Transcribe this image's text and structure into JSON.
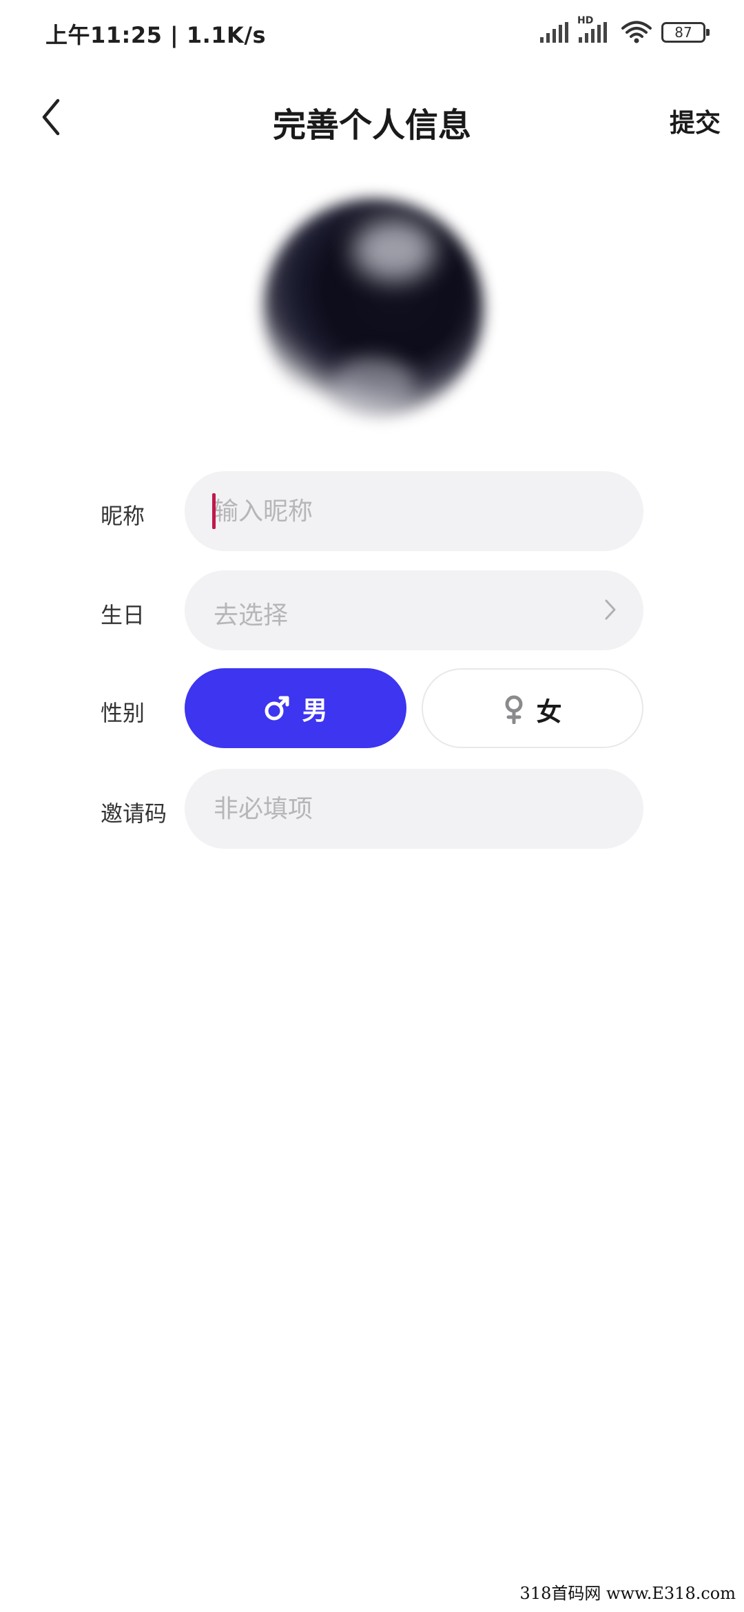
{
  "status_bar": {
    "time_speed": "上午11:25 | 1.1K/s",
    "network_badge": "HD",
    "battery_level": "87"
  },
  "header": {
    "title": "完善个人信息",
    "submit_label": "提交"
  },
  "form": {
    "nickname": {
      "label": "昵称",
      "placeholder": "输入昵称"
    },
    "birthday": {
      "label": "生日",
      "placeholder": "去选择"
    },
    "gender": {
      "label": "性别",
      "options": [
        {
          "label": "男",
          "icon": "male-symbol-icon",
          "selected": true
        },
        {
          "label": "女",
          "icon": "female-symbol-icon",
          "selected": false
        }
      ]
    },
    "invite_code": {
      "label": "邀请码",
      "placeholder": "非必填项"
    }
  },
  "colors": {
    "accent": "#3d35f0",
    "field_bg": "#f2f1f3",
    "caret": "#c0184a"
  },
  "watermark": "318首码网 www.E318.com"
}
